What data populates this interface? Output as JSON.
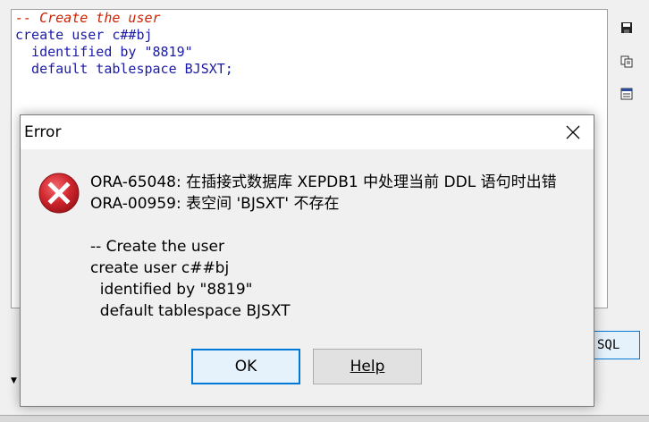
{
  "editor": {
    "lines": [
      "-- Create the user",
      "create user c##bj",
      "  identified by \"8819\"",
      "  default tablespace BJSXT;"
    ]
  },
  "toolbar": {
    "sql_button_label": "SQL"
  },
  "dialog": {
    "title": "Error",
    "message_lines": [
      "ORA-65048: 在插接式数据库 XEPDB1 中处理当前 DDL 语句时出错",
      "ORA-00959: 表空间 'BJSXT' 不存在",
      "",
      "-- Create the user",
      "create user c##bj",
      "  identified by \"8819\"",
      "  default tablespace BJSXT"
    ],
    "ok_label": "OK",
    "help_label": "Help"
  },
  "icons": {
    "error": "error-icon",
    "close": "close-icon",
    "save": "save-icon",
    "copy": "copy-icon",
    "properties": "properties-icon"
  },
  "colors": {
    "error_red": "#d0262d",
    "accent_blue": "#0078d7",
    "comment": "#cc2200",
    "code": "#1a1aa8"
  }
}
